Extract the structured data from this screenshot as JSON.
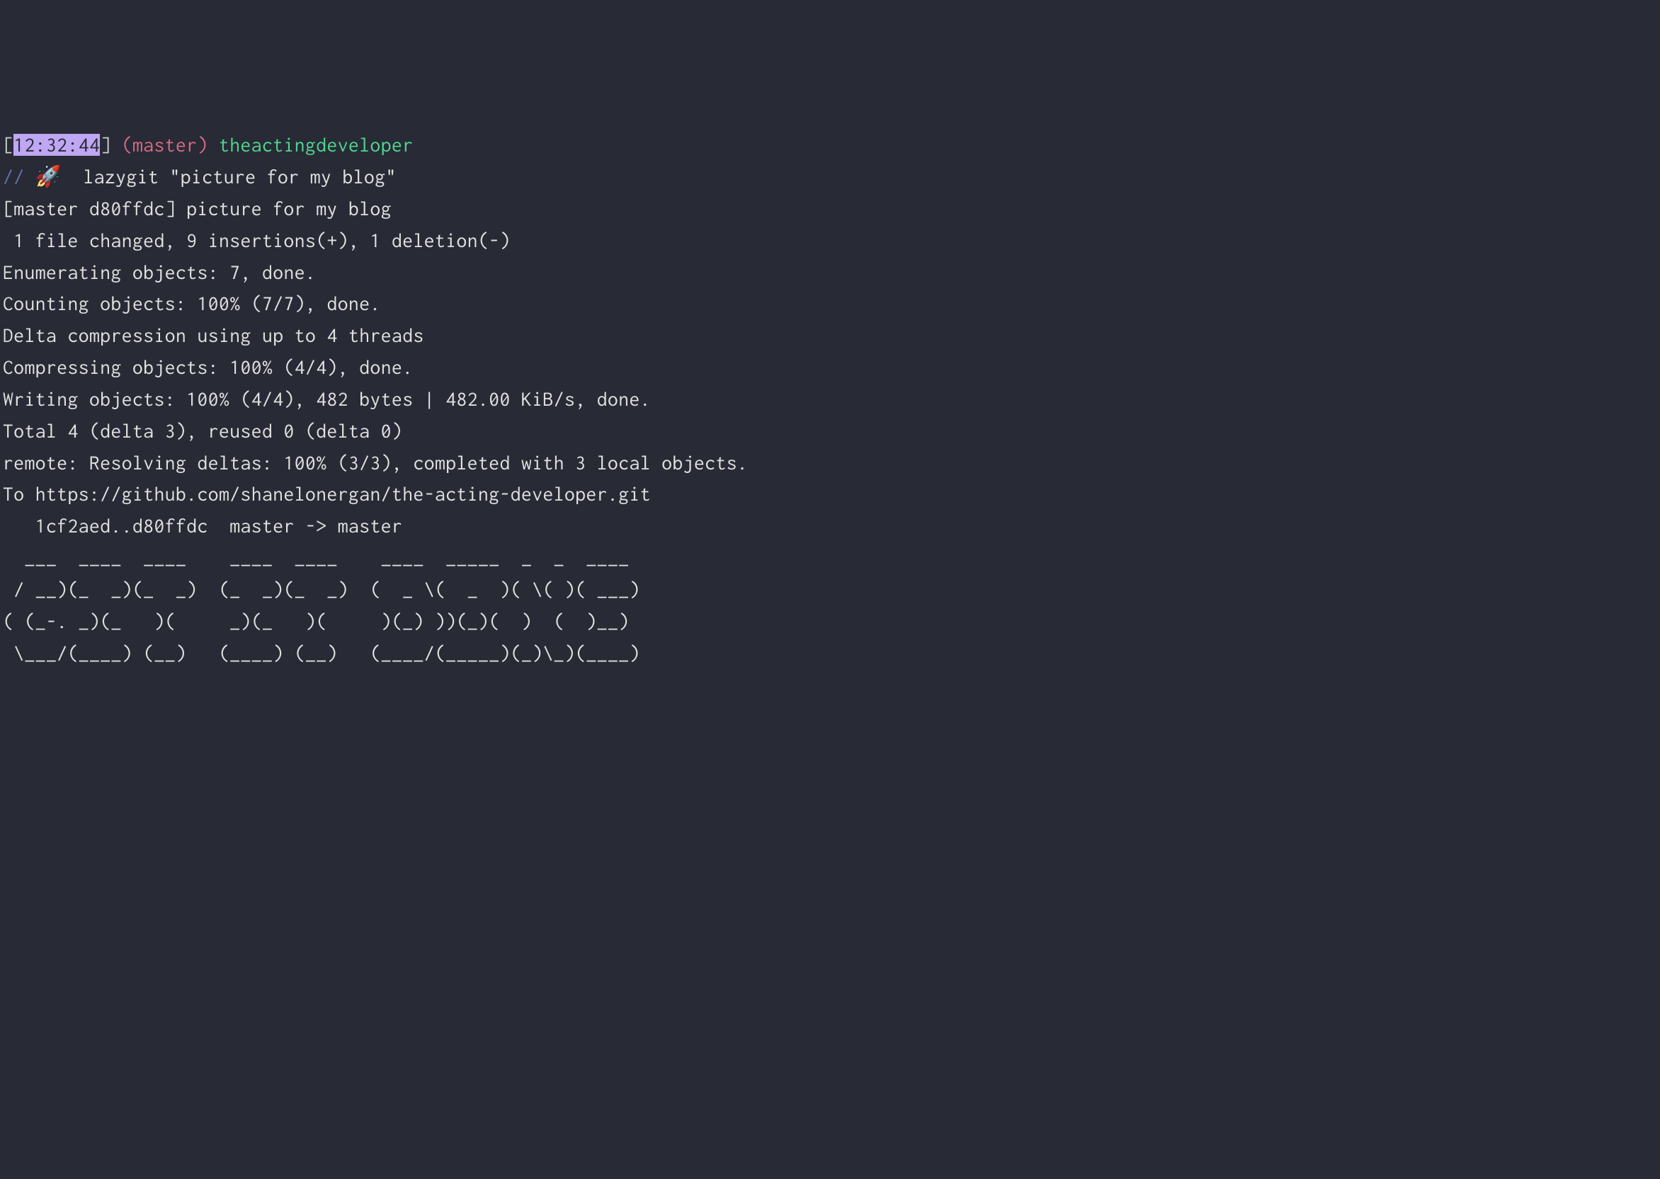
{
  "prompt": {
    "lbracket": "[",
    "time": "12:32:44",
    "rbracket": "]",
    "space1": " ",
    "lparen": "(",
    "branch": "master",
    "rparen": ")",
    "space2": " ",
    "repo": "theactingdeveloper"
  },
  "command": {
    "prefix": "// ",
    "emoji": "🚀",
    "spacer": "  ",
    "text": "lazygit \"picture for my blog\""
  },
  "output": {
    "l1": "[master d80ffdc] picture for my blog",
    "l2": " 1 file changed, 9 insertions(+), 1 deletion(-)",
    "l3": "Enumerating objects: 7, done.",
    "l4": "Counting objects: 100% (7/7), done.",
    "l5": "Delta compression using up to 4 threads",
    "l6": "Compressing objects: 100% (4/4), done.",
    "l7": "Writing objects: 100% (4/4), 482 bytes | 482.00 KiB/s, done.",
    "l8": "Total 4 (delta 3), reused 0 (delta 0)",
    "l9": "remote: Resolving deltas: 100% (3/3), completed with 3 local objects.",
    "l10": "To https://github.com/shanelonergan/the-acting-developer.git",
    "l11": "   1cf2aed..d80ffdc  master -> master",
    "l12": ""
  },
  "ascii": {
    "a1": "  ___  ____  ____    ____  ____    ____  _____  _  _  ____ ",
    "a2": " / __)(_  _)(_  _)  (_  _)(_  _)  (  _ \\(  _  )( \\( )( ___)",
    "a3": "( (_-. _)(_   )(     _)(_   )(     )(_) ))(_)(  )  (  )__) ",
    "a4": " \\___/(____) (__)   (____) (__)   (____/(_____)(_)\\_)(____)"
  }
}
